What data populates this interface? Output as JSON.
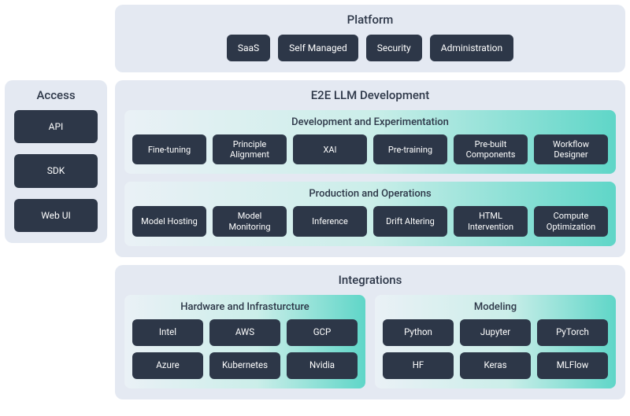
{
  "access": {
    "title": "Access",
    "items": [
      "API",
      "SDK",
      "Web UI"
    ]
  },
  "platform": {
    "title": "Platform",
    "items": [
      "SaaS",
      "Self Managed",
      "Security",
      "Administration"
    ]
  },
  "e2e": {
    "title": "E2E LLM Development",
    "dev": {
      "title": "Development and Experimentation",
      "items": [
        "Fine-tuning",
        "Principle Alignment",
        "XAI",
        "Pre-training",
        "Pre-built Components",
        "Workflow Designer"
      ]
    },
    "prod": {
      "title": "Production and Operations",
      "items": [
        "Model Hosting",
        "Model Monitoring",
        "Inference",
        "Drift Altering",
        "HTML Intervention",
        "Compute Optimization"
      ]
    }
  },
  "integrations": {
    "title": "Integrations",
    "hardware": {
      "title": "Hardware and Infrasturcture",
      "items": [
        "Intel",
        "AWS",
        "GCP",
        "Azure",
        "Kubernetes",
        "Nvidia"
      ]
    },
    "modeling": {
      "title": "Modeling",
      "items": [
        "Python",
        "Jupyter",
        "PyTorch",
        "HF",
        "Keras",
        "MLFlow"
      ]
    }
  }
}
